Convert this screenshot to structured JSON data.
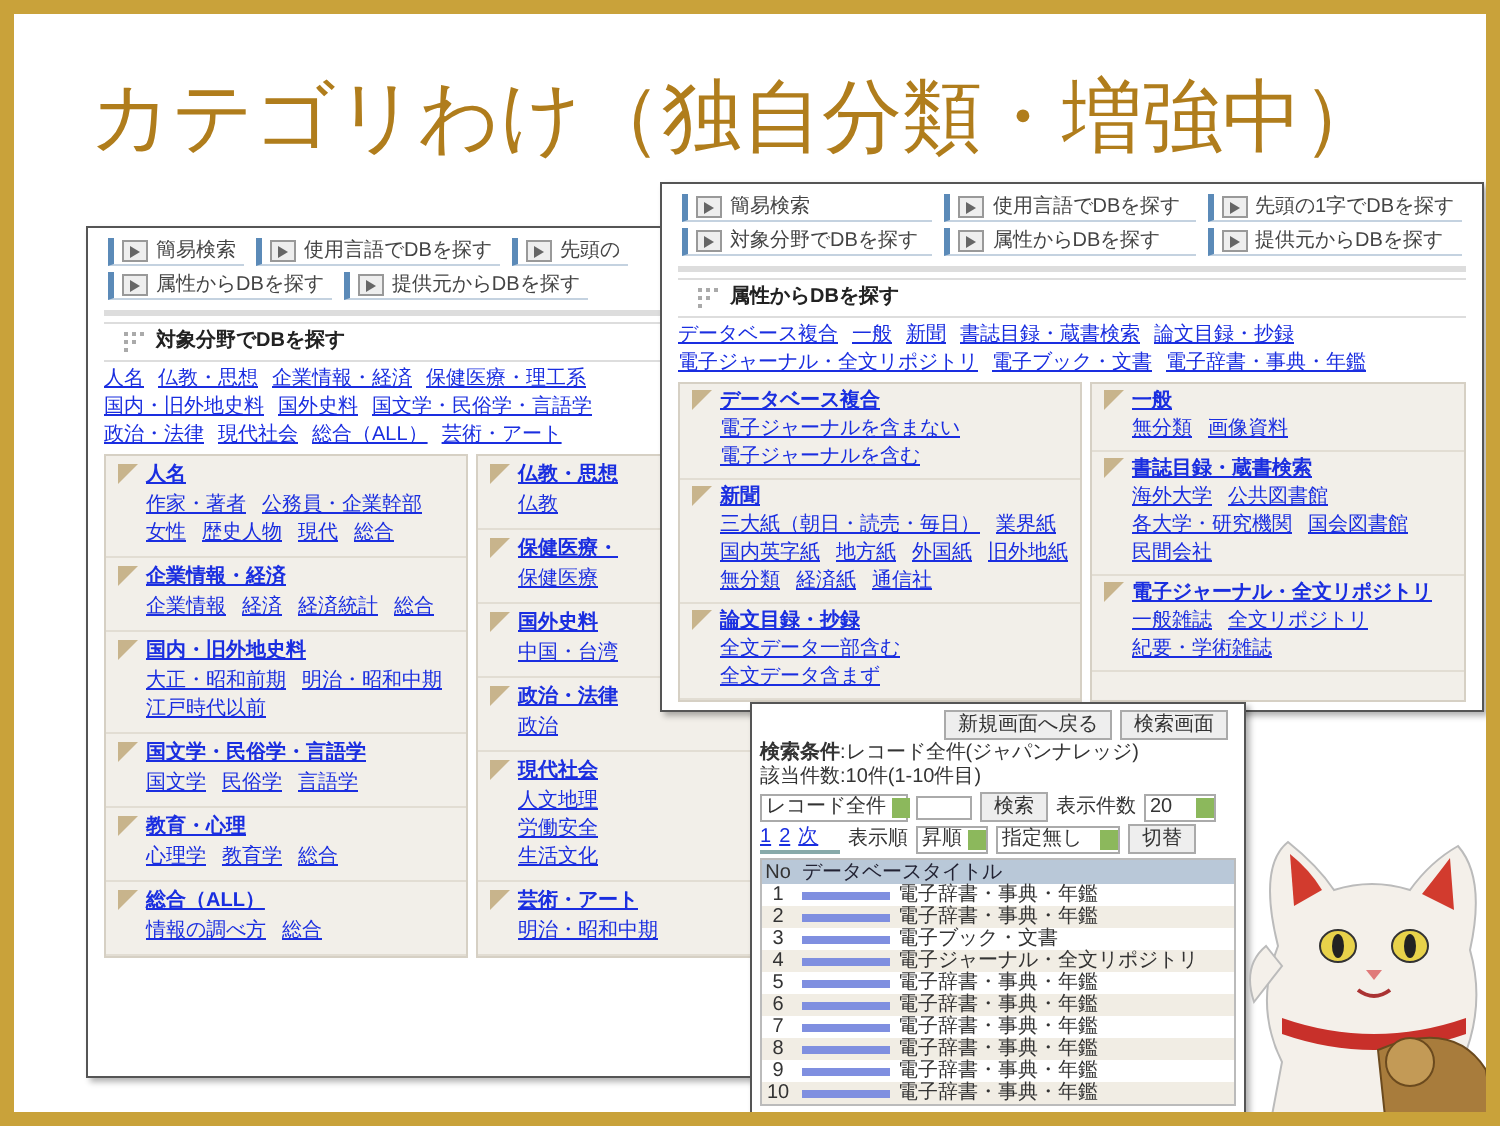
{
  "title": "カテゴリわけ（独自分類・増強中）",
  "windows": [
    {
      "kind": "category",
      "nav": [
        "簡易検索",
        "使用言語でDBを探す",
        "先頭の",
        "属性からDBを探す",
        "提供元からDBを探す"
      ],
      "section_title": "対象分野でDBを探す",
      "links": [
        "人名",
        "仏教・思想",
        "企業情報・経済",
        "保健医療・理工系",
        "国内・旧外地史料",
        "国外史料",
        "国文学・民俗学・言語学",
        "政治・法律",
        "現代社会",
        "総合（ALL）",
        "芸術・アート"
      ],
      "columns": [
        [
          {
            "heading": "人名",
            "links": [
              "作家・著者",
              "公務員・企業幹部",
              "女性",
              "歴史人物",
              "現代",
              "総合"
            ]
          },
          {
            "heading": "企業情報・経済",
            "links": [
              "企業情報",
              "経済",
              "経済統計",
              "総合"
            ]
          },
          {
            "heading": "国内・旧外地史料",
            "links": [
              "大正・昭和前期",
              "明治・昭和中期",
              "江戸時代以前"
            ]
          },
          {
            "heading": "国文学・民俗学・言語学",
            "links": [
              "国文学",
              "民俗学",
              "言語学"
            ]
          },
          {
            "heading": "教育・心理",
            "links": [
              "心理学",
              "教育学",
              "総合"
            ]
          },
          {
            "heading": "総合（ALL）",
            "links": [
              "情報の調べ方",
              "総合"
            ]
          }
        ],
        [
          {
            "heading": "仏教・思想",
            "links": [
              "仏教"
            ]
          },
          {
            "heading": "保健医療・",
            "links": [
              "保健医療"
            ]
          },
          {
            "heading": "国外史料",
            "links": [
              "中国・台湾"
            ]
          },
          {
            "heading": "政治・法律",
            "links": [
              "政治"
            ]
          },
          {
            "heading": "現代社会",
            "links": [
              "人文地理",
              "労働安全",
              "生活文化"
            ]
          },
          {
            "heading": "芸術・アート",
            "links": [
              "明治・昭和中期"
            ]
          }
        ]
      ]
    },
    {
      "kind": "category",
      "nav": [
        "簡易検索",
        "使用言語でDBを探す",
        "先頭の1字でDBを探す",
        "対象分野でDBを探す",
        "属性からDBを探す",
        "提供元からDBを探す"
      ],
      "section_title": "属性からDBを探す",
      "links": [
        "データベース複合",
        "一般",
        "新聞",
        "書誌目録・蔵書検索",
        "論文目録・抄録",
        "電子ジャーナル・全文リポジトリ",
        "電子ブック・文書",
        "電子辞書・事典・年鑑"
      ],
      "columns": [
        [
          {
            "heading": "データベース複合",
            "links": [
              "電子ジャーナルを含まない",
              "電子ジャーナルを含む"
            ]
          },
          {
            "heading": "新聞",
            "links": [
              "三大紙（朝日・読売・毎日）",
              "業界紙",
              "国内英字紙",
              "地方紙",
              "外国紙",
              "旧外地紙",
              "無分類",
              "経済紙",
              "通信社"
            ]
          },
          {
            "heading": "論文目録・抄録",
            "links": [
              "全文データ一部含む",
              "全文データ含まず"
            ]
          }
        ],
        [
          {
            "heading": "一般",
            "links": [
              "無分類",
              "画像資料"
            ]
          },
          {
            "heading": "書誌目録・蔵書検索",
            "links": [
              "海外大学",
              "公共図書館",
              "各大学・研究機関",
              "国会図書館",
              "民間会社"
            ]
          },
          {
            "heading": "電子ジャーナル・全文リポジトリ",
            "links": [
              "一般雑誌",
              "全文リポジトリ",
              "紀要・学術雑誌"
            ]
          }
        ]
      ]
    },
    {
      "kind": "results",
      "buttons": [
        "新規画面へ戻る",
        "検索画面"
      ],
      "condition": "**検索条件**:レコード全件(ジャパンナレッジ)",
      "count": "該当件数:10件(1-10件目)",
      "search": {
        "select": "レコード全件",
        "button": "検索",
        "per_page_label": "表示件数",
        "per_page": "20"
      },
      "pager": [
        "1",
        "2",
        "次"
      ],
      "sort": {
        "label": "表示順",
        "order": "昇順",
        "field": "指定無し",
        "button": "切替"
      },
      "table": {
        "columns": [
          "No",
          "データベースタイトル"
        ],
        "rows": [
          {
            "no": "1",
            "genre": "電子辞書・事典・年鑑"
          },
          {
            "no": "2",
            "genre": "電子辞書・事典・年鑑"
          },
          {
            "no": "3",
            "genre": "電子ブック・文書"
          },
          {
            "no": "4",
            "genre": "電子ジャーナル・全文リポジトリ"
          },
          {
            "no": "5",
            "genre": "電子辞書・事典・年鑑"
          },
          {
            "no": "6",
            "genre": "電子辞書・事典・年鑑"
          },
          {
            "no": "7",
            "genre": "電子辞書・事典・年鑑"
          },
          {
            "no": "8",
            "genre": "電子辞書・事典・年鑑"
          },
          {
            "no": "9",
            "genre": "電子辞書・事典・年鑑"
          },
          {
            "no": "10",
            "genre": "電子辞書・事典・年鑑"
          }
        ]
      }
    }
  ]
}
